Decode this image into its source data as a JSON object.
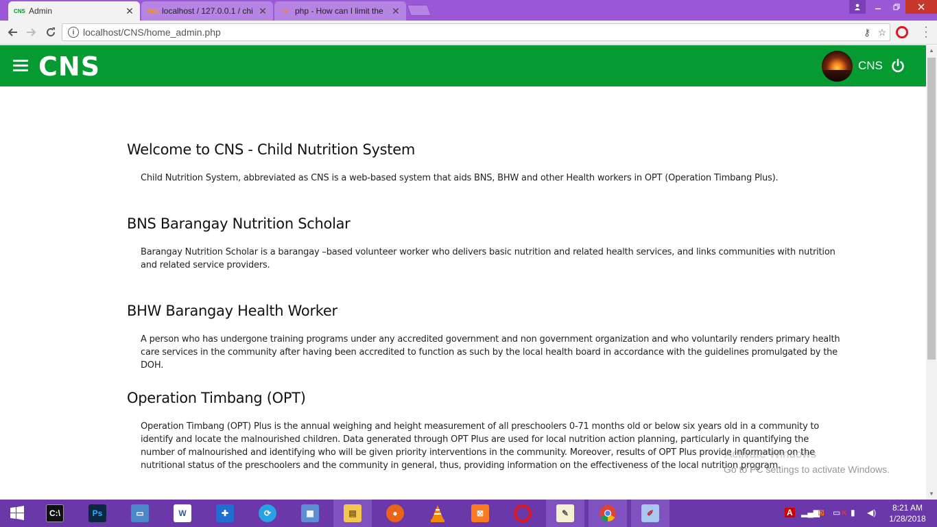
{
  "browser": {
    "tabs": [
      {
        "favicon": "CNS",
        "title": "Admin",
        "active": true
      },
      {
        "favicon": "PMA",
        "title": "localhost / 127.0.0.1 / chi",
        "active": false
      },
      {
        "favicon": "SO",
        "title": "php - How can I limit the",
        "active": false
      }
    ],
    "url": "localhost/CNS/home_admin.php"
  },
  "header": {
    "brand": "CNS",
    "user_name": "CNS",
    "color": "#069a33"
  },
  "sections": [
    {
      "title": "Welcome to CNS - Child Nutrition System",
      "body": "Child Nutrition System, abbreviated as CNS is a web-based system that aids BNS, BHW and other Health workers in OPT (Operation Timbang Plus)."
    },
    {
      "title": "BNS Barangay Nutrition Scholar",
      "body": "Barangay Nutrition Scholar is a barangay –based volunteer worker who delivers basic nutrition and related health services, and links communities with nutrition and related service providers."
    },
    {
      "title": "BHW Barangay Health Worker",
      "body": "A person who has undergone training programs under any accredited government and non government organization and who voluntarily renders primary health care services in the community after having been accredited to function as such by the local health board in accordance with the guidelines promulgated by the DOH."
    },
    {
      "title": "Operation Timbang (OPT)",
      "body": "Operation Timbang (OPT) Plus is the annual weighing and height measurement of all preschoolers 0-71 months old or below six years old in a community to identify and locate the malnourished children. Data generated through OPT Plus are used for local nutrition action planning, particularly in quantifying the number of malnourished and identifying who will be given priority interventions in the community. Moreover, results of OPT Plus provide information on the nutritional status of the preschoolers and the community in general, thus, providing information on the effectiveness of the local nutrition program."
    }
  ],
  "watermark": {
    "line1": "Activate Windows",
    "line2": "Go to PC settings to activate Windows."
  },
  "taskbar": {
    "time": "8:21 AM",
    "date": "1/28/2018"
  }
}
